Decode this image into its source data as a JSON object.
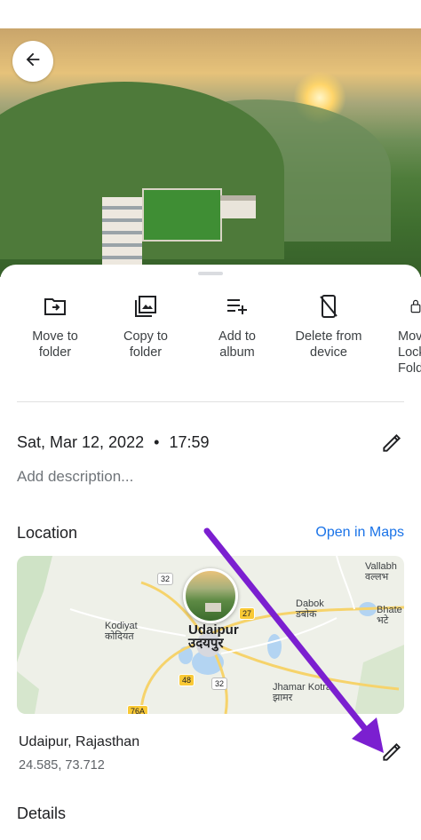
{
  "header": {
    "back_icon": "arrow-back-icon"
  },
  "actions": [
    {
      "icon": "move-to-folder-icon",
      "label": "Move to\nfolder"
    },
    {
      "icon": "copy-to-folder-icon",
      "label": "Copy to\nfolder"
    },
    {
      "icon": "add-to-album-icon",
      "label": "Add to\nalbum"
    },
    {
      "icon": "delete-from-device-icon",
      "label": "Delete from\ndevice"
    },
    {
      "icon": "locked-folder-icon",
      "label": "Move\nLock\nFold"
    }
  ],
  "info": {
    "date": "Sat, Mar 12, 2022",
    "separator": "•",
    "time": "17:59",
    "description_placeholder": "Add description..."
  },
  "location": {
    "title": "Location",
    "open_maps": "Open in Maps",
    "place": "Udaipur, Rajasthan",
    "coords": "24.585, 73.712",
    "map": {
      "labels": {
        "udaipur_en": "Udaipur",
        "udaipur_hi": "उदयपुर",
        "kodiyat_en": "Kodiyat",
        "kodiyat_hi": "कोदियत",
        "dabok_en": "Dabok",
        "dabok_hi": "डबोक",
        "vallabh_en": "Vallabh",
        "vallabh_hi": "वल्लभ",
        "bhate_en": "Bhate",
        "bhate_hi": "भटे",
        "jhamar_en": "Jhamar Kotra",
        "jhamar_hi": "झामर"
      },
      "shields": [
        "32",
        "27",
        "48",
        "32",
        "76A"
      ]
    }
  },
  "details": {
    "title": "Details"
  },
  "colors": {
    "accent": "#1a73e8",
    "annotation_arrow": "#7b1fd0"
  }
}
